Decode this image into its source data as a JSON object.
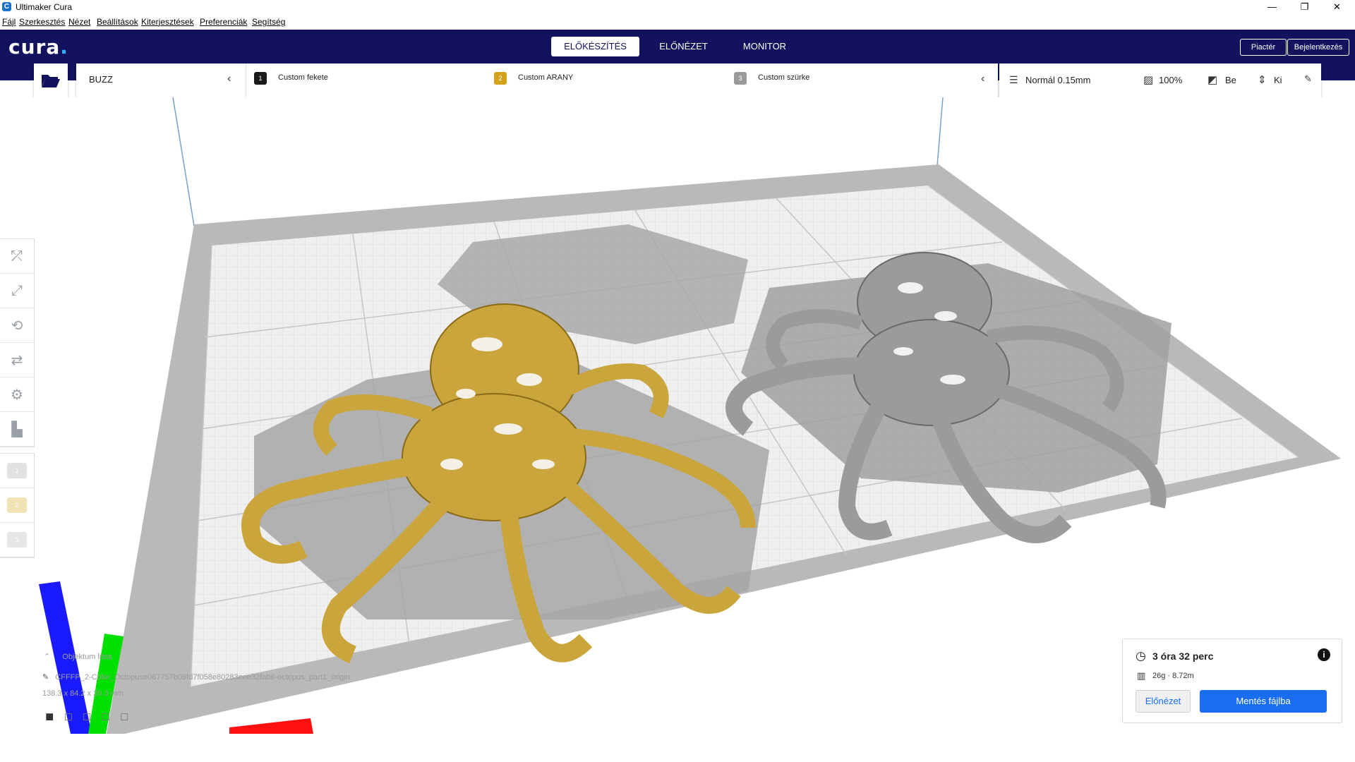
{
  "window": {
    "title": "Ultimaker Cura",
    "minimize": "—",
    "restore": "❐",
    "close": "✕"
  },
  "menu": [
    "Fájl",
    "Szerkesztés",
    "Nézet",
    "Beállítások",
    "Kiterjesztések",
    "Preferenciák",
    "Segítség"
  ],
  "header": {
    "logo": "cura",
    "tabs": [
      "ELŐKÉSZÍTÉS",
      "ELŐNÉZET",
      "MONITOR"
    ],
    "active_tab": "ELŐKÉSZÍTÉS",
    "marketplace": "Piactér",
    "signin": "Bejelentkezés"
  },
  "printer": {
    "name": "BUZZ"
  },
  "extruders": [
    {
      "num": "1",
      "name": "Custom fekete",
      "color": "#1a1a1a"
    },
    {
      "num": "2",
      "name": "Custom ARANY",
      "color": "#d4a21a"
    },
    {
      "num": "3",
      "name": "Custom szürke",
      "color": "#9a9a9a"
    }
  ],
  "settings": {
    "profile": "Normál 0.15mm",
    "infill": "100%",
    "support": "Be",
    "adhesion": "Ki"
  },
  "object": {
    "list_label": "Objektum lista",
    "filename": "CFFFP_2-Color_Octopuse067757b09fd7f058e80283eee32fab6-octopus_part1_origin",
    "dimensions": "138.3 x 84.2 x 20.3 mm"
  },
  "summary": {
    "time": "3 óra 32 perc",
    "material": "26g · 8.72m",
    "preview_btn": "Előnézet",
    "save_btn": "Mentés fájlba"
  },
  "colors": {
    "header": "#12125f",
    "accent": "#196ef0",
    "gold": "#c9a53c",
    "gray": "#9b9b9b"
  }
}
